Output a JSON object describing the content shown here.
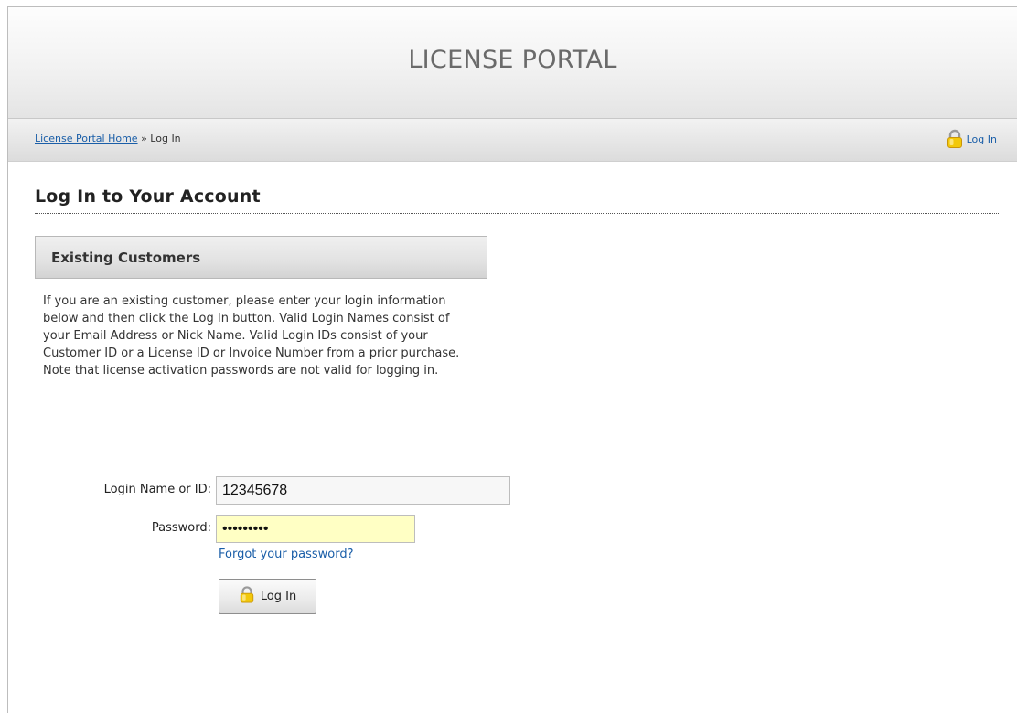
{
  "header": {
    "title": "LICENSE PORTAL"
  },
  "nav": {
    "breadcrumb_home": "License Portal Home",
    "breadcrumb_separator": "»",
    "breadcrumb_current": "Log In",
    "login_link": "Log In",
    "login_icon": "lock-icon"
  },
  "main": {
    "page_title": "Log In to Your Account",
    "section_title": "Existing Customers",
    "intro": "If you are an existing customer, please enter your login information below and then click the Log In button. Valid Login Names consist of your Email Address or Nick Name. Valid Login IDs consist of your Customer ID or a License ID or Invoice Number from a prior purchase. Note that license activation passwords are not valid for logging in."
  },
  "form": {
    "login_label": "Login Name or ID:",
    "login_value": "12345678",
    "password_label": "Password:",
    "password_value": "xxxxxxxxx",
    "forgot_link": "Forgot your password?",
    "submit_label": "Log In",
    "submit_icon": "lock-icon"
  },
  "colors": {
    "link": "#1a5ea8",
    "password_field_bg": "#ffffc4",
    "lock_icon": "#f2c80a"
  }
}
